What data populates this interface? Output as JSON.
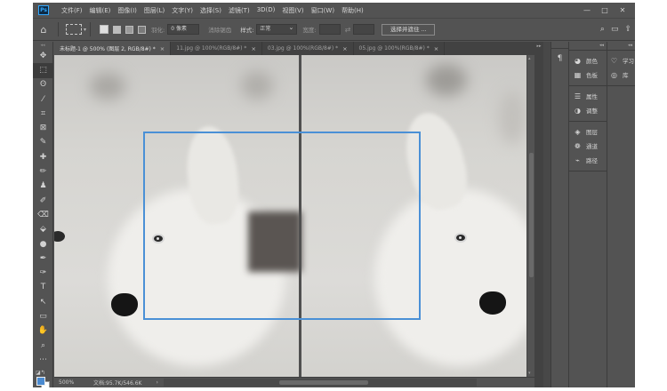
{
  "app": {
    "logo": "Ps"
  },
  "menu": [
    "文件(F)",
    "编辑(E)",
    "图像(I)",
    "图层(L)",
    "文字(Y)",
    "选择(S)",
    "滤镜(T)",
    "3D(D)",
    "视图(V)",
    "窗口(W)",
    "帮助(H)"
  ],
  "window_controls": {
    "minimize": "—",
    "maximize": "□",
    "close": "✕"
  },
  "options": {
    "feather_label": "羽化:",
    "feather_value": "0 像素",
    "antialias_label": "消除锯齿",
    "style_label": "样式:",
    "style_value": "正常",
    "width_label": "宽度:",
    "swap_icon": "⇄",
    "select_mask_label": "选择并遮住 ..."
  },
  "tabs": [
    {
      "label": "未标题-1 @ 500% (图层 2, RGB/8#) *",
      "close": "×",
      "active": true
    },
    {
      "label": "11.jpg @ 100%(RGB/8#) *",
      "close": "×",
      "active": false
    },
    {
      "label": "03.jpg @ 100%(RGB/8#) *",
      "close": "×",
      "active": false
    },
    {
      "label": "05.jpg @ 100%(RGB/8#) *",
      "close": "×",
      "active": false
    }
  ],
  "tools": [
    "✥",
    "⬚",
    "ʘ",
    "⁄",
    "⌗",
    "⊠",
    "✎",
    "✚",
    "✏",
    "♟",
    "✐",
    "⌫",
    "⬙",
    "●",
    "✒",
    "✑",
    "T",
    "↖",
    "▭",
    "✋",
    "⌕",
    "⋯"
  ],
  "colors": {
    "foreground": "#4a8ad0",
    "background": "#ffffff",
    "selection": "#4a90d6"
  },
  "status": {
    "zoom": "500%",
    "doc": "文档:95.7K/546.6K",
    "arrow": "›"
  },
  "panels": {
    "narrow_icon": "¶",
    "group1": [
      {
        "icon": "◕",
        "label": "颜色"
      },
      {
        "icon": "▦",
        "label": "色板"
      }
    ],
    "group2": [
      {
        "icon": "☰",
        "label": "属性"
      },
      {
        "icon": "◑",
        "label": "调整"
      }
    ],
    "group3": [
      {
        "icon": "◈",
        "label": "图层"
      },
      {
        "icon": "❁",
        "label": "通道"
      },
      {
        "icon": "⌁",
        "label": "路径"
      }
    ],
    "right_group": [
      {
        "icon": "♡",
        "label": "学习"
      },
      {
        "icon": "◎",
        "label": "库"
      }
    ]
  }
}
